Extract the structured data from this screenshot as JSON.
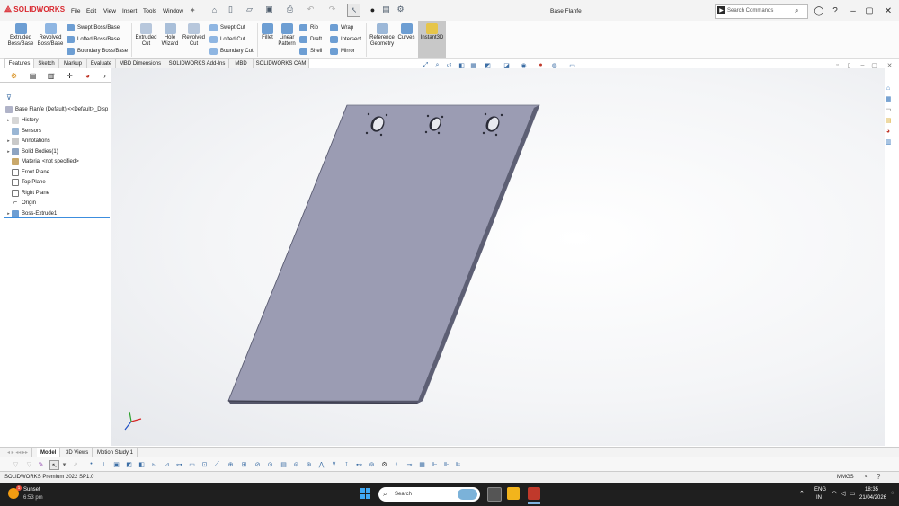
{
  "app": {
    "logo": "SOLIDWORKS",
    "menu": [
      "File",
      "Edit",
      "View",
      "Insert",
      "Tools",
      "Window"
    ],
    "doc_title": "Base Flanfe",
    "search_placeholder": "Search Commands"
  },
  "ribbon": {
    "extruded_boss": "Extruded\nBoss/Base",
    "revolved_boss": "Revolved\nBoss/Base",
    "swept_boss": "Swept Boss/Base",
    "lofted_boss": "Lofted Boss/Base",
    "boundary_boss": "Boundary Boss/Base",
    "extruded_cut": "Extruded\nCut",
    "hole_wizard": "Hole\nWizard",
    "revolved_cut": "Revolved\nCut",
    "swept_cut": "Swept Cut",
    "lofted_cut": "Lofted Cut",
    "boundary_cut": "Boundary Cut",
    "fillet": "Fillet",
    "linear_pattern": "Linear\nPattern",
    "rib": "Rib",
    "draft": "Draft",
    "shell": "Shell",
    "wrap": "Wrap",
    "intersect": "Intersect",
    "mirror": "Mirror",
    "reference_geometry": "Reference\nGeometry",
    "curves": "Curves",
    "instant3d": "Instant3D"
  },
  "command_tabs": [
    "Features",
    "Sketch",
    "Markup",
    "Evaluate",
    "MBD Dimensions",
    "SOLIDWORKS Add-Ins",
    "MBD",
    "SOLIDWORKS CAM"
  ],
  "tree": {
    "root": "Base Flanfe (Default) <<Default>_Disp",
    "items": [
      "History",
      "Sensors",
      "Annotations",
      "Solid Bodies(1)",
      "Material <not specified>",
      "Front Plane",
      "Top Plane",
      "Right Plane",
      "Origin",
      "Boss-Extrude1"
    ]
  },
  "bottom_tabs": [
    "Model",
    "3D Views",
    "Motion Study 1"
  ],
  "status": {
    "left": "SOLIDWORKS Premium 2022 SP1.0",
    "units": "MMGS"
  },
  "taskbar": {
    "weather": "Sunset",
    "weather_time": "6:53 pm",
    "weather_badge": "1",
    "search": "Search",
    "lang1": "ENG",
    "lang2": "IN",
    "time": "18:35",
    "date": "21/04/2026"
  },
  "colors": {
    "brand": "#d9272e",
    "part_face": "#9b9cb3",
    "part_edge": "#6e7083",
    "instant3d_bg": "#c8c8c8"
  }
}
